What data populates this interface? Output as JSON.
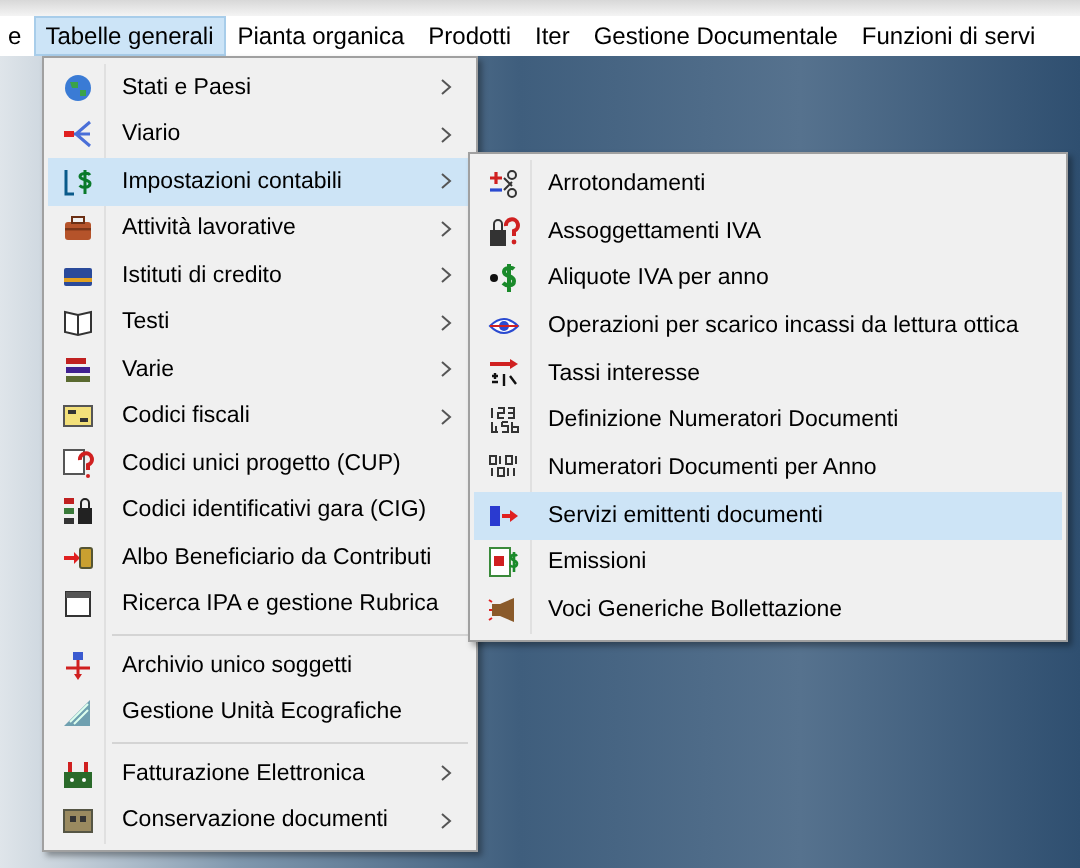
{
  "menubar": [
    {
      "label": "e",
      "selected": false
    },
    {
      "label": "Tabelle generali",
      "selected": true
    },
    {
      "label": "Pianta organica",
      "selected": false
    },
    {
      "label": "Prodotti",
      "selected": false
    },
    {
      "label": "Iter",
      "selected": false
    },
    {
      "label": "Gestione Documentale",
      "selected": false
    },
    {
      "label": "Funzioni di servi",
      "selected": false
    }
  ],
  "menu": {
    "sections": [
      [
        {
          "label": "Stati e Paesi",
          "submenu": true,
          "selected": false
        },
        {
          "label": "Viario",
          "submenu": true,
          "selected": false
        },
        {
          "label": "Impostazioni contabili",
          "submenu": true,
          "selected": true
        },
        {
          "label": "Attività lavorative",
          "submenu": true,
          "selected": false
        },
        {
          "label": "Istituti di credito",
          "submenu": true,
          "selected": false
        },
        {
          "label": "Testi",
          "submenu": true,
          "selected": false
        },
        {
          "label": "Varie",
          "submenu": true,
          "selected": false
        },
        {
          "label": "Codici fiscali",
          "submenu": true,
          "selected": false
        },
        {
          "label": "Codici unici progetto (CUP)",
          "submenu": false,
          "selected": false
        },
        {
          "label": "Codici identificativi gara (CIG)",
          "submenu": false,
          "selected": false
        },
        {
          "label": "Albo Beneficiario da Contributi",
          "submenu": false,
          "selected": false
        },
        {
          "label": "Ricerca IPA e gestione Rubrica",
          "submenu": false,
          "selected": false
        }
      ],
      [
        {
          "label": "Archivio unico soggetti",
          "submenu": false,
          "selected": false
        },
        {
          "label": "Gestione Unità Ecografiche",
          "submenu": false,
          "selected": false
        }
      ],
      [
        {
          "label": "Fatturazione Elettronica",
          "submenu": true,
          "selected": false
        },
        {
          "label": "Conservazione documenti",
          "submenu": true,
          "selected": false
        }
      ]
    ]
  },
  "submenu": {
    "items": [
      {
        "label": "Arrotondamenti",
        "selected": false
      },
      {
        "label": "Assoggettamenti IVA",
        "selected": false
      },
      {
        "label": "Aliquote IVA per anno",
        "selected": false
      },
      {
        "label": "Operazioni per scarico incassi da lettura ottica",
        "selected": false
      },
      {
        "label": "Tassi interesse",
        "selected": false
      },
      {
        "label": "Definizione Numeratori Documenti",
        "selected": false
      },
      {
        "label": "Numeratori Documenti per Anno",
        "selected": false
      },
      {
        "label": "Servizi emittenti documenti",
        "selected": true
      },
      {
        "label": "Emissioni",
        "selected": false
      },
      {
        "label": "Voci Generiche Bollettazione",
        "selected": false
      }
    ]
  }
}
